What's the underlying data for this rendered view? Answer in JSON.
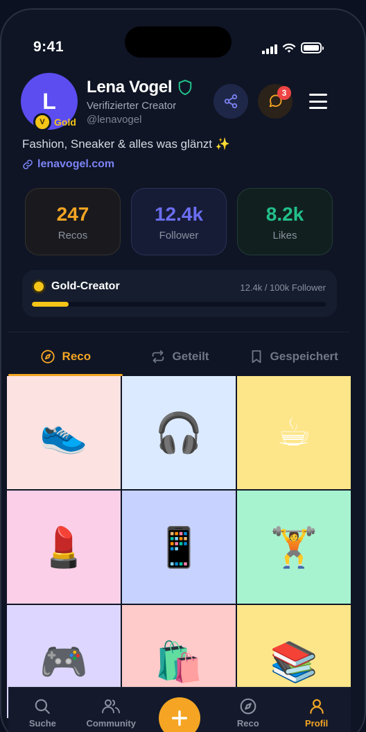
{
  "status_bar": {
    "time": "9:41"
  },
  "profile": {
    "avatar_initial": "L",
    "tier_label": "Gold",
    "tier_coin_letter": "V",
    "name": "Lena Vogel",
    "subtitle": "Verifizierter Creator",
    "handle": "@lenavogel",
    "bio": "Fashion, Sneaker & alles was glänzt ✨",
    "link": "lenavogel.com"
  },
  "header_actions": {
    "notification_count": "3"
  },
  "stats": [
    {
      "value": "247",
      "label": "Recos",
      "color": "#f5a523"
    },
    {
      "value": "12.4k",
      "label": "Follower",
      "color": "#6b6ef0"
    },
    {
      "value": "8.2k",
      "label": "Likes",
      "color": "#22c08a"
    }
  ],
  "creator_progress": {
    "title": "Gold-Creator",
    "count": "12.4k / 100k Follower",
    "fraction": 0.124
  },
  "tabs": [
    {
      "label": "Reco",
      "icon": "compass-icon",
      "active": true
    },
    {
      "label": "Geteilt",
      "icon": "repost-icon",
      "active": false
    },
    {
      "label": "Gespeichert",
      "icon": "bookmark-icon",
      "active": false
    }
  ],
  "grid": [
    {
      "emoji": "👟",
      "bg": "#fde2e2"
    },
    {
      "emoji": "🎧",
      "bg": "#dbeafe"
    },
    {
      "emoji": "☕",
      "bg": "#fde68a"
    },
    {
      "emoji": "💄",
      "bg": "#fbcfe8"
    },
    {
      "emoji": "📱",
      "bg": "#c7d2fe"
    },
    {
      "emoji": "🏋️",
      "bg": "#a7f3d0"
    },
    {
      "emoji": "🎮",
      "bg": "#ddd6fe"
    },
    {
      "emoji": "🛍️",
      "bg": "#fecaca"
    },
    {
      "emoji": "📚",
      "bg": "#fde68a"
    }
  ],
  "bottom_nav": [
    {
      "label": "Suche",
      "icon": "search-icon"
    },
    {
      "label": "Community",
      "icon": "community-icon"
    },
    {
      "label": "",
      "icon": "plus-icon"
    },
    {
      "label": "Reco",
      "icon": "compass-icon"
    },
    {
      "label": "Profil",
      "icon": "profile-icon",
      "active": true
    }
  ],
  "colors": {
    "accent": "#f5a523",
    "gold": "#f5c518",
    "brand": "#5b4df0",
    "link": "#7c83f5"
  }
}
